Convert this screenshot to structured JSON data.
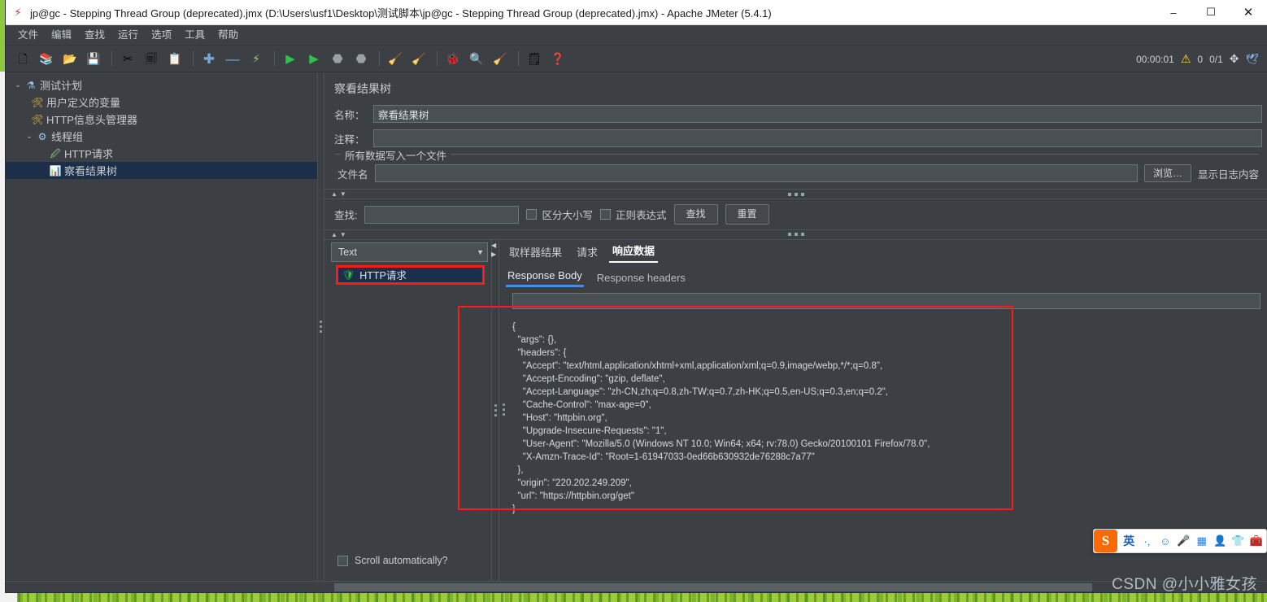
{
  "window": {
    "title": "jp@gc - Stepping Thread Group (deprecated).jmx (D:\\Users\\usf1\\Desktop\\测试脚本\\jp@gc - Stepping Thread Group (deprecated).jmx) - Apache JMeter (5.4.1)",
    "app_icon": "jmeter-feather-icon",
    "minimize": "–",
    "maximize": "☐",
    "close": "✕"
  },
  "menubar": {
    "items": [
      {
        "label": "文件"
      },
      {
        "label": "编辑"
      },
      {
        "label": "查找"
      },
      {
        "label": "运行"
      },
      {
        "label": "选项"
      },
      {
        "label": "工具"
      },
      {
        "label": "帮助"
      }
    ]
  },
  "toolbar": {
    "buttons": [
      {
        "name": "new-icon",
        "glyph": "📄"
      },
      {
        "name": "templates-icon",
        "glyph": "📚"
      },
      {
        "name": "open-icon",
        "glyph": "📂"
      },
      {
        "name": "save-icon",
        "glyph": "💾"
      },
      {
        "name": "cut-icon",
        "glyph": "✂"
      },
      {
        "name": "copy-icon",
        "glyph": "🗐"
      },
      {
        "name": "paste-icon",
        "glyph": "📋"
      },
      {
        "name": "expand-icon",
        "glyph": "✚"
      },
      {
        "name": "collapse-icon",
        "glyph": "—"
      },
      {
        "name": "toggle-icon",
        "glyph": "⚡"
      },
      {
        "name": "start-icon",
        "glyph": "▶"
      },
      {
        "name": "start-no-pauses-icon",
        "glyph": "▶"
      },
      {
        "name": "stop-icon",
        "glyph": "⬣"
      },
      {
        "name": "shutdown-icon",
        "glyph": "⬣"
      },
      {
        "name": "clear-icon",
        "glyph": "🧹"
      },
      {
        "name": "clear-all-icon",
        "glyph": "🧹"
      },
      {
        "name": "function-helper-icon",
        "glyph": "🐞"
      },
      {
        "name": "search-icon",
        "glyph": "🔍"
      },
      {
        "name": "reset-search-icon",
        "glyph": "🧹"
      },
      {
        "name": "log-viewer-icon",
        "glyph": "📑"
      },
      {
        "name": "help-icon",
        "glyph": "❓"
      }
    ],
    "status": {
      "elapsed": "00:00:01",
      "warning_icon": "warning-triangle-icon",
      "warning_count": "0",
      "threads": "0/1",
      "connect_icon": "remote-engine-icon",
      "lang_icon": "jmeter-bird-icon"
    }
  },
  "tree": {
    "nodes": [
      {
        "label": "测试计划",
        "icon": "test-plan-icon",
        "indent": 0,
        "twist": "⌄",
        "selected": false
      },
      {
        "label": "用户定义的变量",
        "icon": "user-variables-icon",
        "indent": 1,
        "twist": "",
        "selected": false
      },
      {
        "label": "HTTP信息头管理器",
        "icon": "header-manager-icon",
        "indent": 1,
        "twist": "",
        "selected": false
      },
      {
        "label": "线程组",
        "icon": "thread-group-icon",
        "indent": 1,
        "twist": "⌄",
        "selected": false
      },
      {
        "label": "HTTP请求",
        "icon": "http-request-icon",
        "indent": 2,
        "twist": "",
        "selected": false
      },
      {
        "label": "察看结果树",
        "icon": "view-results-tree-icon",
        "indent": 2,
        "twist": "",
        "selected": true
      }
    ]
  },
  "panel": {
    "title": "察看结果树",
    "name_label": "名称：",
    "name_value": "察看结果树",
    "comment_label": "注释：",
    "comment_value": "",
    "file_group_legend": "所有数据写入一个文件",
    "filename_label": "文件名",
    "filename_value": "",
    "browse_button": "浏览…",
    "log_display_label": "显示日志内容",
    "search": {
      "label": "查找:",
      "value": "",
      "case_sensitive_label": "区分大小写",
      "regex_label": "正则表达式",
      "find_button": "查找",
      "reset_button": "重置"
    }
  },
  "results": {
    "renderer_value": "Text",
    "renderer_caret": "▼",
    "items": [
      {
        "label": "HTTP请求",
        "status_icon": "success-shield-icon",
        "selected": true,
        "highlighted": true
      }
    ],
    "scroll_automatically_label": "Scroll automatically?",
    "scroll_automatically_checked": false
  },
  "detail": {
    "tabs_primary": [
      {
        "label": "取样器结果",
        "active": false
      },
      {
        "label": "请求",
        "active": false
      },
      {
        "label": "响应数据",
        "active": true
      }
    ],
    "tabs_secondary": [
      {
        "label": "Response Body",
        "active": true
      },
      {
        "label": "Response headers",
        "active": false
      }
    ],
    "filter_value": "",
    "response_body": "{\n  \"args\": {},\n  \"headers\": {\n    \"Accept\": \"text/html,application/xhtml+xml,application/xml;q=0.9,image/webp,*/*;q=0.8\",\n    \"Accept-Encoding\": \"gzip, deflate\",\n    \"Accept-Language\": \"zh-CN,zh;q=0.8,zh-TW;q=0.7,zh-HK;q=0.5,en-US;q=0.3,en;q=0.2\",\n    \"Cache-Control\": \"max-age=0\",\n    \"Host\": \"httpbin.org\",\n    \"Upgrade-Insecure-Requests\": \"1\",\n    \"User-Agent\": \"Mozilla/5.0 (Windows NT 10.0; Win64; x64; rv:78.0) Gecko/20100101 Firefox/78.0\",\n    \"X-Amzn-Trace-Id\": \"Root=1-61947033-0ed66b630932de76288c7a77\"\n  },\n  \"origin\": \"220.202.249.209\",\n  \"url\": \"https://httpbin.org/get\"\n}"
  },
  "ime": {
    "logo": "S",
    "icons": [
      {
        "name": "lang-chinese-icon",
        "glyph": "英"
      },
      {
        "name": "punctuation-icon",
        "glyph": "·,"
      },
      {
        "name": "emoji-icon",
        "glyph": "☺"
      },
      {
        "name": "voice-input-icon",
        "glyph": "🎤"
      },
      {
        "name": "soft-keyboard-icon",
        "glyph": "▦"
      },
      {
        "name": "user-icon",
        "glyph": "👤"
      },
      {
        "name": "skin-icon",
        "glyph": "👕"
      },
      {
        "name": "toolbox-icon",
        "glyph": "🧰"
      }
    ]
  },
  "watermark": {
    "text": "CSDN @小小雅女孩"
  },
  "colors": {
    "accent_red": "#ff1a1a",
    "tab_underline": "#4a90d9",
    "selection": "#1b2e4a",
    "panel_bg": "#3c4044",
    "desktop": "#8dc63f"
  }
}
